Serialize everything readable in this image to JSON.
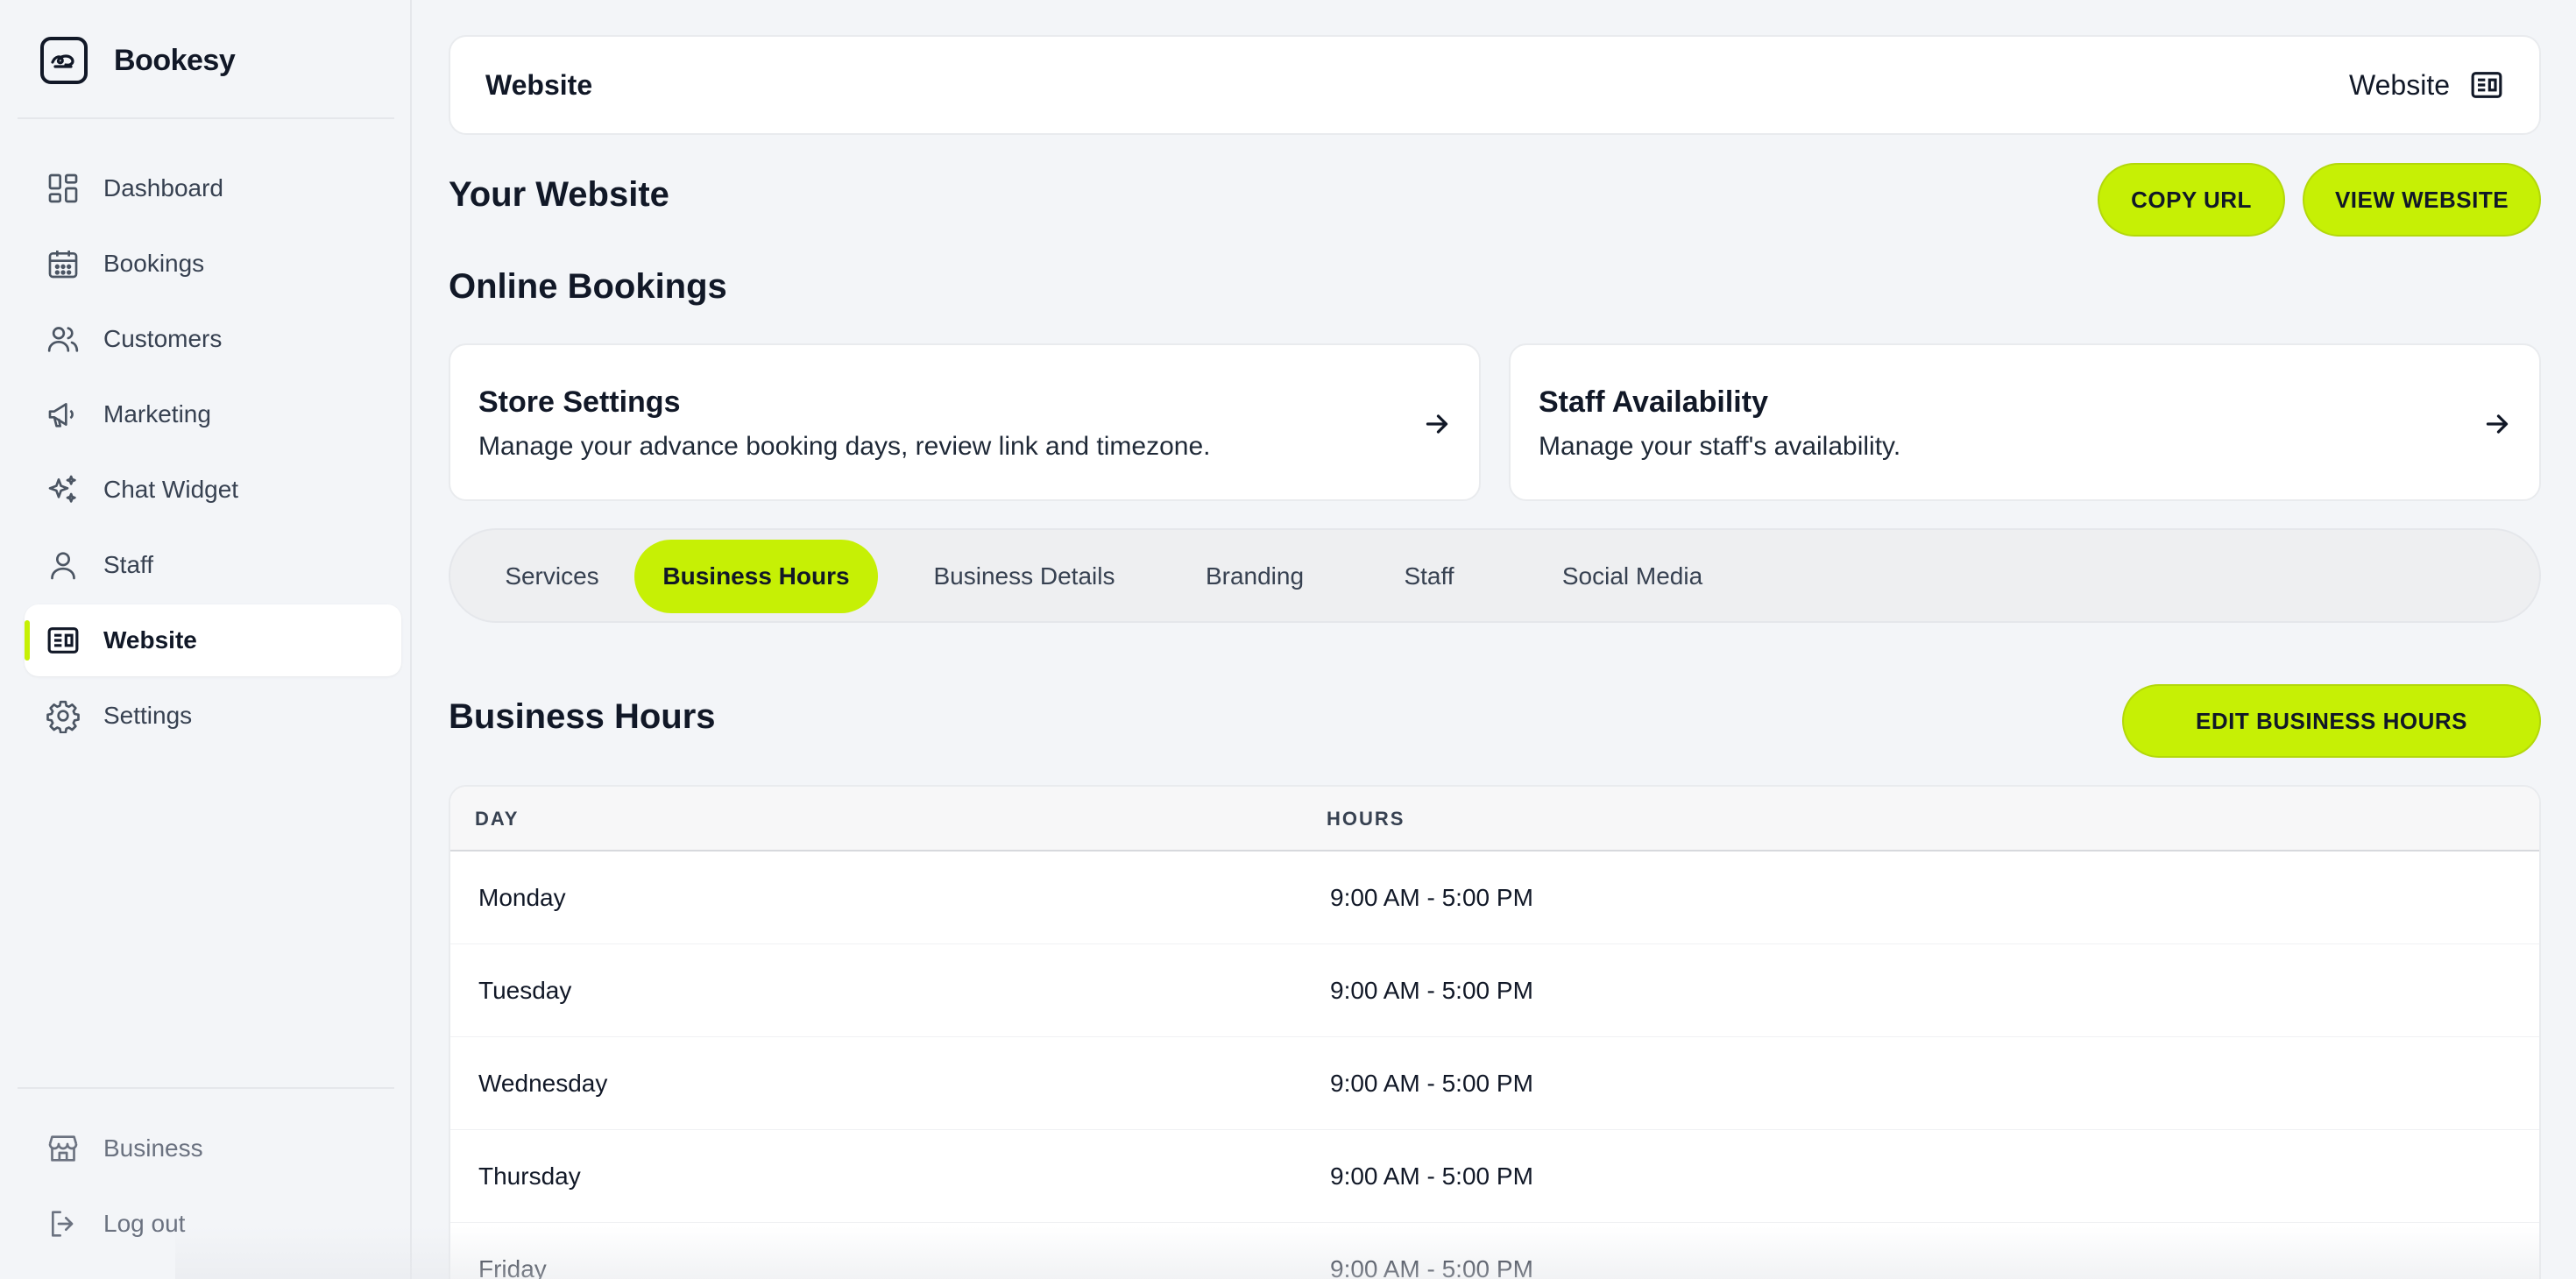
{
  "app": {
    "name": "Bookesy"
  },
  "sidebar": {
    "items": [
      {
        "label": "Dashboard",
        "icon": "dashboard-icon"
      },
      {
        "label": "Bookings",
        "icon": "calendar-icon"
      },
      {
        "label": "Customers",
        "icon": "users-icon"
      },
      {
        "label": "Marketing",
        "icon": "megaphone-icon"
      },
      {
        "label": "Chat Widget",
        "icon": "sparkles-icon"
      },
      {
        "label": "Staff",
        "icon": "user-icon"
      },
      {
        "label": "Website",
        "icon": "newspaper-icon",
        "active": true
      },
      {
        "label": "Settings",
        "icon": "gear-icon"
      }
    ],
    "bottom": [
      {
        "label": "Business",
        "icon": "store-icon"
      },
      {
        "label": "Log out",
        "icon": "logout-icon"
      }
    ]
  },
  "topbar": {
    "title": "Website",
    "right_label": "Website"
  },
  "page": {
    "title": "Your Website",
    "copy_url": "COPY URL",
    "view_website": "VIEW WEBSITE",
    "online_bookings": "Online Bookings"
  },
  "cards": [
    {
      "title": "Store Settings",
      "desc": "Manage your advance booking days, review link and timezone."
    },
    {
      "title": "Staff Availability",
      "desc": "Manage your staff's availability."
    }
  ],
  "tabs": [
    {
      "label": "Services"
    },
    {
      "label": "Business Hours",
      "active": true
    },
    {
      "label": "Business Details"
    },
    {
      "label": "Branding"
    },
    {
      "label": "Staff"
    },
    {
      "label": "Social Media"
    }
  ],
  "business_hours": {
    "title": "Business Hours",
    "edit_button": "EDIT BUSINESS HOURS",
    "columns": [
      "DAY",
      "HOURS"
    ],
    "rows": [
      {
        "day": "Monday",
        "hours": "9:00 AM - 5:00 PM"
      },
      {
        "day": "Tuesday",
        "hours": "9:00 AM - 5:00 PM"
      },
      {
        "day": "Wednesday",
        "hours": "9:00 AM - 5:00 PM"
      },
      {
        "day": "Thursday",
        "hours": "9:00 AM - 5:00 PM"
      },
      {
        "day": "Friday",
        "hours": "9:00 AM - 5:00 PM"
      }
    ]
  },
  "colors": {
    "accent": "#c6f005",
    "background": "#f3f5f8",
    "text": "#111827"
  }
}
